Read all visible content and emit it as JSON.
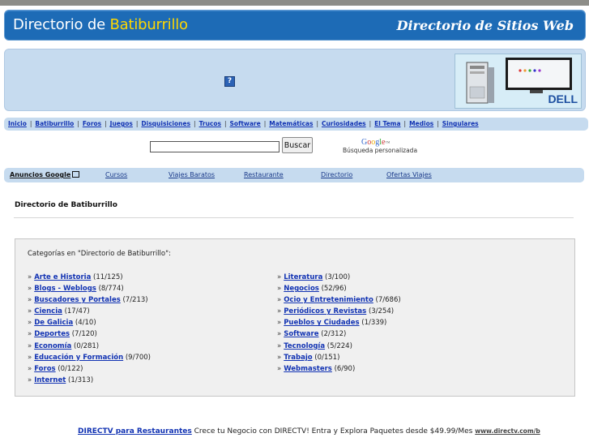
{
  "header": {
    "title_prefix": "Directorio de",
    "title_highlight": "Batiburrillo",
    "subtitle": "Directorio de Sitios Web"
  },
  "ad": {
    "info_icon": "?",
    "brand": "DELL"
  },
  "nav": {
    "items": [
      "Inicio",
      "Batiburrillo",
      "Foros",
      "Juegos",
      "Disquisiciones",
      "Trucos",
      "Software",
      "Matemáticas",
      "Curiosidades",
      "El Tema",
      "Medios",
      "Singulares"
    ],
    "separator": "|"
  },
  "search": {
    "button_label": "Buscar",
    "google_logo": "Google™",
    "google_sub": "Búsqueda personalizada"
  },
  "adlinks": {
    "label": "Anuncios Google",
    "links": [
      "Cursos",
      "Viajes Baratos",
      "Restaurante",
      "Directorio",
      "Ofertas Viajes"
    ]
  },
  "directory": {
    "title": "Directorio de Batiburrillo",
    "intro": "Categorías en \"Directorio de Batiburrillo\":",
    "bullet": "»",
    "col1": [
      {
        "name": "Arte e Historia",
        "count": "(11/125)"
      },
      {
        "name": "Blogs - Weblogs",
        "count": "(8/774)"
      },
      {
        "name": "Buscadores y Portales",
        "count": "(7/213)"
      },
      {
        "name": "Ciencia",
        "count": "(17/47)"
      },
      {
        "name": "De Galicia",
        "count": "(4/10)"
      },
      {
        "name": "Deportes",
        "count": "(7/120)"
      },
      {
        "name": "Economía",
        "count": "(0/281)"
      },
      {
        "name": "Educación y Formación",
        "count": "(9/700)"
      },
      {
        "name": "Foros",
        "count": "(0/122)"
      },
      {
        "name": "Internet",
        "count": "(1/313)"
      }
    ],
    "col2": [
      {
        "name": "Literatura",
        "count": "(3/100)"
      },
      {
        "name": "Negocios",
        "count": "(52/96)"
      },
      {
        "name": "Ocio y Entretenimiento",
        "count": "(7/686)"
      },
      {
        "name": "Periódicos y Revistas",
        "count": "(3/254)"
      },
      {
        "name": "Pueblos y Ciudades",
        "count": "(1/339)"
      },
      {
        "name": "Software",
        "count": "(2/312)"
      },
      {
        "name": "Tecnología",
        "count": "(5/224)"
      },
      {
        "name": "Trabajo",
        "count": "(0/151)"
      },
      {
        "name": "Webmasters",
        "count": "(6/90)"
      }
    ]
  },
  "footer_ad": {
    "link": "DIRECTV para Restaurantes",
    "text": "Crece tu Negocio con DIRECTV! Entra y Explora Paquetes desde $49.99/Mes",
    "url": "www.directv.com/b"
  },
  "colors": {
    "header_bg": "#1d6bb6",
    "panel_bg": "#c6dbef",
    "link": "#1233b3",
    "title_highlight": "#ffd700"
  }
}
